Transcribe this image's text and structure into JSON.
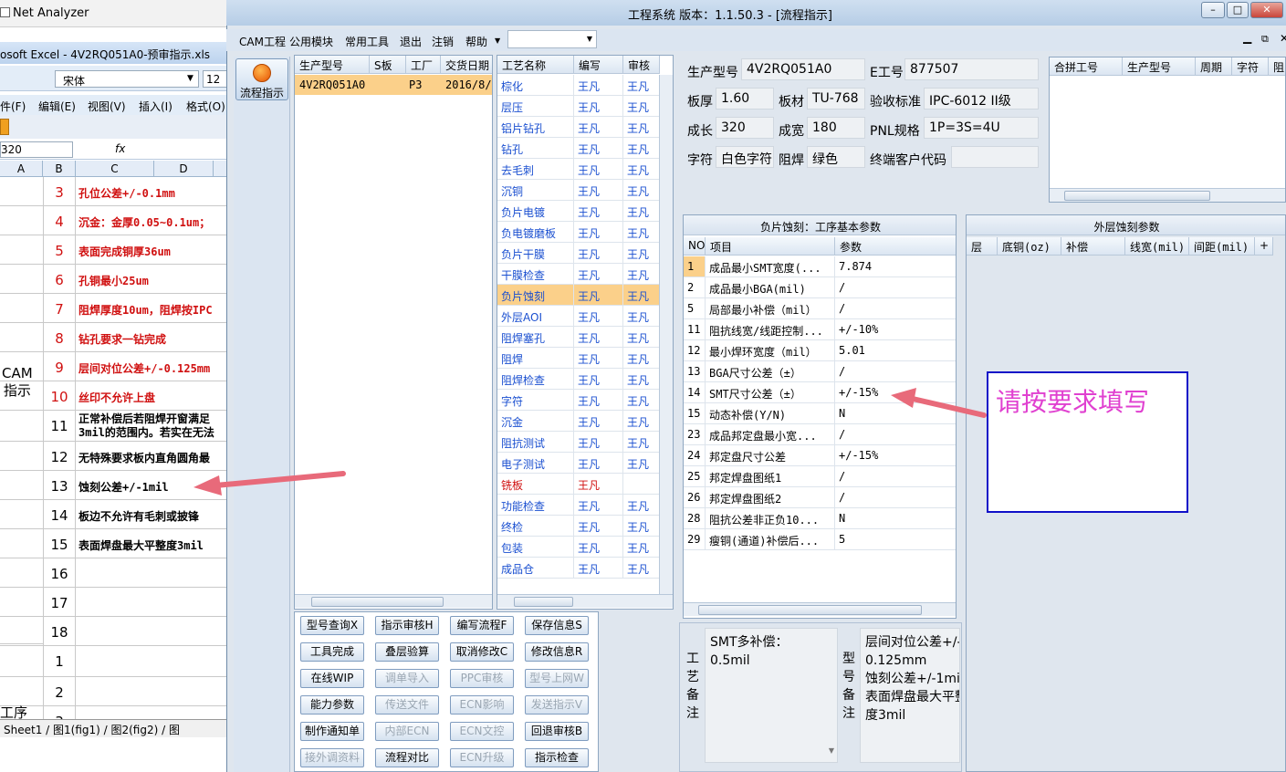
{
  "net_analyzer": {
    "title": "Net Analyzer"
  },
  "excel": {
    "title": "osoft Excel - 4V2RQ051A0-预审指示.xls",
    "font_name": "宋体",
    "font_size": "12",
    "menu": [
      "件(F)",
      "编辑(E)",
      "视图(V)",
      "插入(I)",
      "格式(O)"
    ],
    "name_box": "320",
    "fx": "fx",
    "columns": [
      "A",
      "B",
      "C",
      "D"
    ],
    "rows": [
      {
        "n": "3",
        "text": "孔位公差+/-0.1mm",
        "red": true
      },
      {
        "n": "4",
        "text": "沉金：金厚0.05~0.1um；",
        "red": true
      },
      {
        "n": "5",
        "text": "表面完成铜厚36um",
        "red": true
      },
      {
        "n": "6",
        "text": "孔铜最小25um",
        "red": true
      },
      {
        "n": "7",
        "text": "阻焊厚度10um，阻焊按IPC",
        "red": true
      },
      {
        "n": "8",
        "text": "钻孔要求一钻完成",
        "red": true
      },
      {
        "n": "9",
        "text": "层间对位公差+/-0.125mm",
        "red": true
      },
      {
        "n": "10",
        "text": "丝印不允许上盘",
        "red": true
      },
      {
        "n": "11",
        "text": "正常补偿后若阻焊开窗满足",
        "text2": "3mil的范围内。若实在无法",
        "red": false
      },
      {
        "n": "12",
        "text": "无特殊要求板内直角圆角最",
        "red": false
      },
      {
        "n": "13",
        "text": "蚀刻公差+/-1mil",
        "red": false
      },
      {
        "n": "14",
        "text": "板边不允许有毛刺或披锋",
        "red": false
      },
      {
        "n": "15",
        "text": "表面焊盘最大平整度3mil",
        "red": false
      },
      {
        "n": "16",
        "text": "",
        "red": false
      },
      {
        "n": "17",
        "text": "",
        "red": false
      },
      {
        "n": "18",
        "text": "",
        "red": false
      },
      {
        "n": "1",
        "text": "",
        "red": false
      },
      {
        "n": "2",
        "text": "",
        "red": false
      },
      {
        "n": "3",
        "text": "",
        "red": false
      }
    ],
    "cam_label_1": "CAM",
    "cam_label_2": "指示",
    "gongxu_label": "工序",
    "sheet_tabs": "Sheet1 / 图1(fig1) / 图2(fig2) / 图"
  },
  "window": {
    "title": "工程系统   版本：1.1.50.3 - [流程指示]",
    "menu": [
      "CAM工程",
      "公用模块",
      "常用工具",
      "退出",
      "注销",
      "帮助"
    ],
    "nav_button": "流程指示"
  },
  "jobs_grid": {
    "headers": [
      "生产型号",
      "S板",
      "工厂",
      "交货日期"
    ],
    "rows": [
      [
        "4V2RQ051A0",
        "",
        "P3",
        "2016/8/"
      ]
    ]
  },
  "process_grid": {
    "headers": [
      "工艺名称",
      "编写",
      "审核"
    ],
    "rows": [
      [
        "棕化",
        "王凡",
        "王凡"
      ],
      [
        "层压",
        "王凡",
        "王凡"
      ],
      [
        "铝片钻孔",
        "王凡",
        "王凡"
      ],
      [
        "钻孔",
        "王凡",
        "王凡"
      ],
      [
        "去毛刺",
        "王凡",
        "王凡"
      ],
      [
        "沉铜",
        "王凡",
        "王凡"
      ],
      [
        "负片电镀",
        "王凡",
        "王凡"
      ],
      [
        "负电镀磨板",
        "王凡",
        "王凡"
      ],
      [
        "负片干膜",
        "王凡",
        "王凡"
      ],
      [
        "干膜检查",
        "王凡",
        "王凡"
      ],
      [
        "负片蚀刻",
        "王凡",
        "王凡"
      ],
      [
        "外层AOI",
        "王凡",
        "王凡"
      ],
      [
        "阻焊塞孔",
        "王凡",
        "王凡"
      ],
      [
        "阻焊",
        "王凡",
        "王凡"
      ],
      [
        "阻焊检查",
        "王凡",
        "王凡"
      ],
      [
        "字符",
        "王凡",
        "王凡"
      ],
      [
        "沉金",
        "王凡",
        "王凡"
      ],
      [
        "阻抗测试",
        "王凡",
        "王凡"
      ],
      [
        "电子测试",
        "王凡",
        "王凡"
      ],
      [
        "铣板",
        "王凡",
        ""
      ],
      [
        "功能检查",
        "王凡",
        "王凡"
      ],
      [
        "终检",
        "王凡",
        "王凡"
      ],
      [
        "包装",
        "王凡",
        "王凡"
      ],
      [
        "成品仓",
        "王凡",
        "王凡"
      ]
    ],
    "selected_index": 10,
    "red_index": 19
  },
  "buttons": [
    [
      "型号查询X",
      "指示审核H",
      "编写流程F",
      "保存信息S"
    ],
    [
      "工具完成",
      "叠层验算",
      "取消修改C",
      "修改信息R"
    ],
    [
      "在线WIP",
      "调单导入",
      "PPC审核",
      "型号上网W"
    ],
    [
      "能力参数",
      "传送文件",
      "ECN影响",
      "发送指示V"
    ],
    [
      "制作通知单",
      "内部ECN",
      "ECN文控",
      "回退审核B"
    ],
    [
      "接外调资料",
      "流程对比",
      "ECN升级",
      "指示检查"
    ]
  ],
  "buttons_disabled": [
    [
      false,
      false,
      false,
      false
    ],
    [
      false,
      false,
      false,
      false
    ],
    [
      false,
      true,
      true,
      true
    ],
    [
      false,
      true,
      true,
      true
    ],
    [
      false,
      true,
      true,
      false
    ],
    [
      true,
      false,
      true,
      false
    ]
  ],
  "info": {
    "model_label": "生产型号",
    "model": "4V2RQ051A0",
    "eno_label": "E工号",
    "eno": "877507",
    "thick_label": "板厚",
    "thick": "1.60",
    "mat_label": "板材",
    "mat": "TU-768",
    "std_label": "验收标准",
    "std": "IPC-6012 II级",
    "len_label": "成长",
    "len": "320",
    "wid_label": "成宽",
    "wid": "180",
    "pnl_label": "PNL规格",
    "pnl": "1P=3S=4U",
    "char_label": "字符",
    "char": "白色字符",
    "mask_label": "阻焊",
    "mask": "绿色",
    "cust_label": "终端客户代码",
    "cust": ""
  },
  "merge_grid": {
    "headers": [
      "合拼工号",
      "生产型号",
      "周期",
      "字符",
      "阻"
    ]
  },
  "param_panel": {
    "title": "负片蚀刻：工序基本参数",
    "headers": [
      "NO",
      "项目",
      "参数"
    ],
    "rows": [
      [
        "1",
        "成品最小SMT宽度(...",
        "7.874"
      ],
      [
        "2",
        "成品最小BGA(mil)",
        "/"
      ],
      [
        "5",
        "局部最小补偿（mil）",
        "/"
      ],
      [
        "11",
        "阻抗线宽/线距控制...",
        "+/-10%"
      ],
      [
        "12",
        "最小焊环宽度（mil）",
        "5.01"
      ],
      [
        "13",
        "BGA尺寸公差（±）",
        "/"
      ],
      [
        "14",
        "SMT尺寸公差（±）",
        "+/-15%"
      ],
      [
        "15",
        "动态补偿(Y/N)",
        "N"
      ],
      [
        "23",
        "成品邦定盘最小宽...",
        "/"
      ],
      [
        "24",
        "邦定盘尺寸公差",
        "+/-15%"
      ],
      [
        "25",
        "邦定焊盘图纸1",
        "/"
      ],
      [
        "26",
        "邦定焊盘图纸2",
        "/"
      ],
      [
        "28",
        "阻抗公差非正负10...",
        "N"
      ],
      [
        "29",
        "瘦铜(通道)补偿后...",
        "5"
      ]
    ],
    "selected_index": 0
  },
  "outer_panel": {
    "title": "外层蚀刻参数",
    "headers": [
      "层",
      "底铜(oz)",
      "补偿",
      "线宽(mil)",
      "间距(mil)",
      "+"
    ]
  },
  "remarks": {
    "proc_label": [
      "工",
      "艺",
      "备",
      "注"
    ],
    "proc_text": [
      "SMT多补偿：",
      "0.5mil"
    ],
    "model_label": [
      "型",
      "号",
      "备",
      "注"
    ],
    "model_text": [
      "层间对位公差+/-",
      "0.125mm",
      "蚀刻公差+/-1mi",
      "表面焊盘最大平整",
      "度3mil"
    ]
  },
  "annotation": {
    "text": "请按要求填写"
  }
}
